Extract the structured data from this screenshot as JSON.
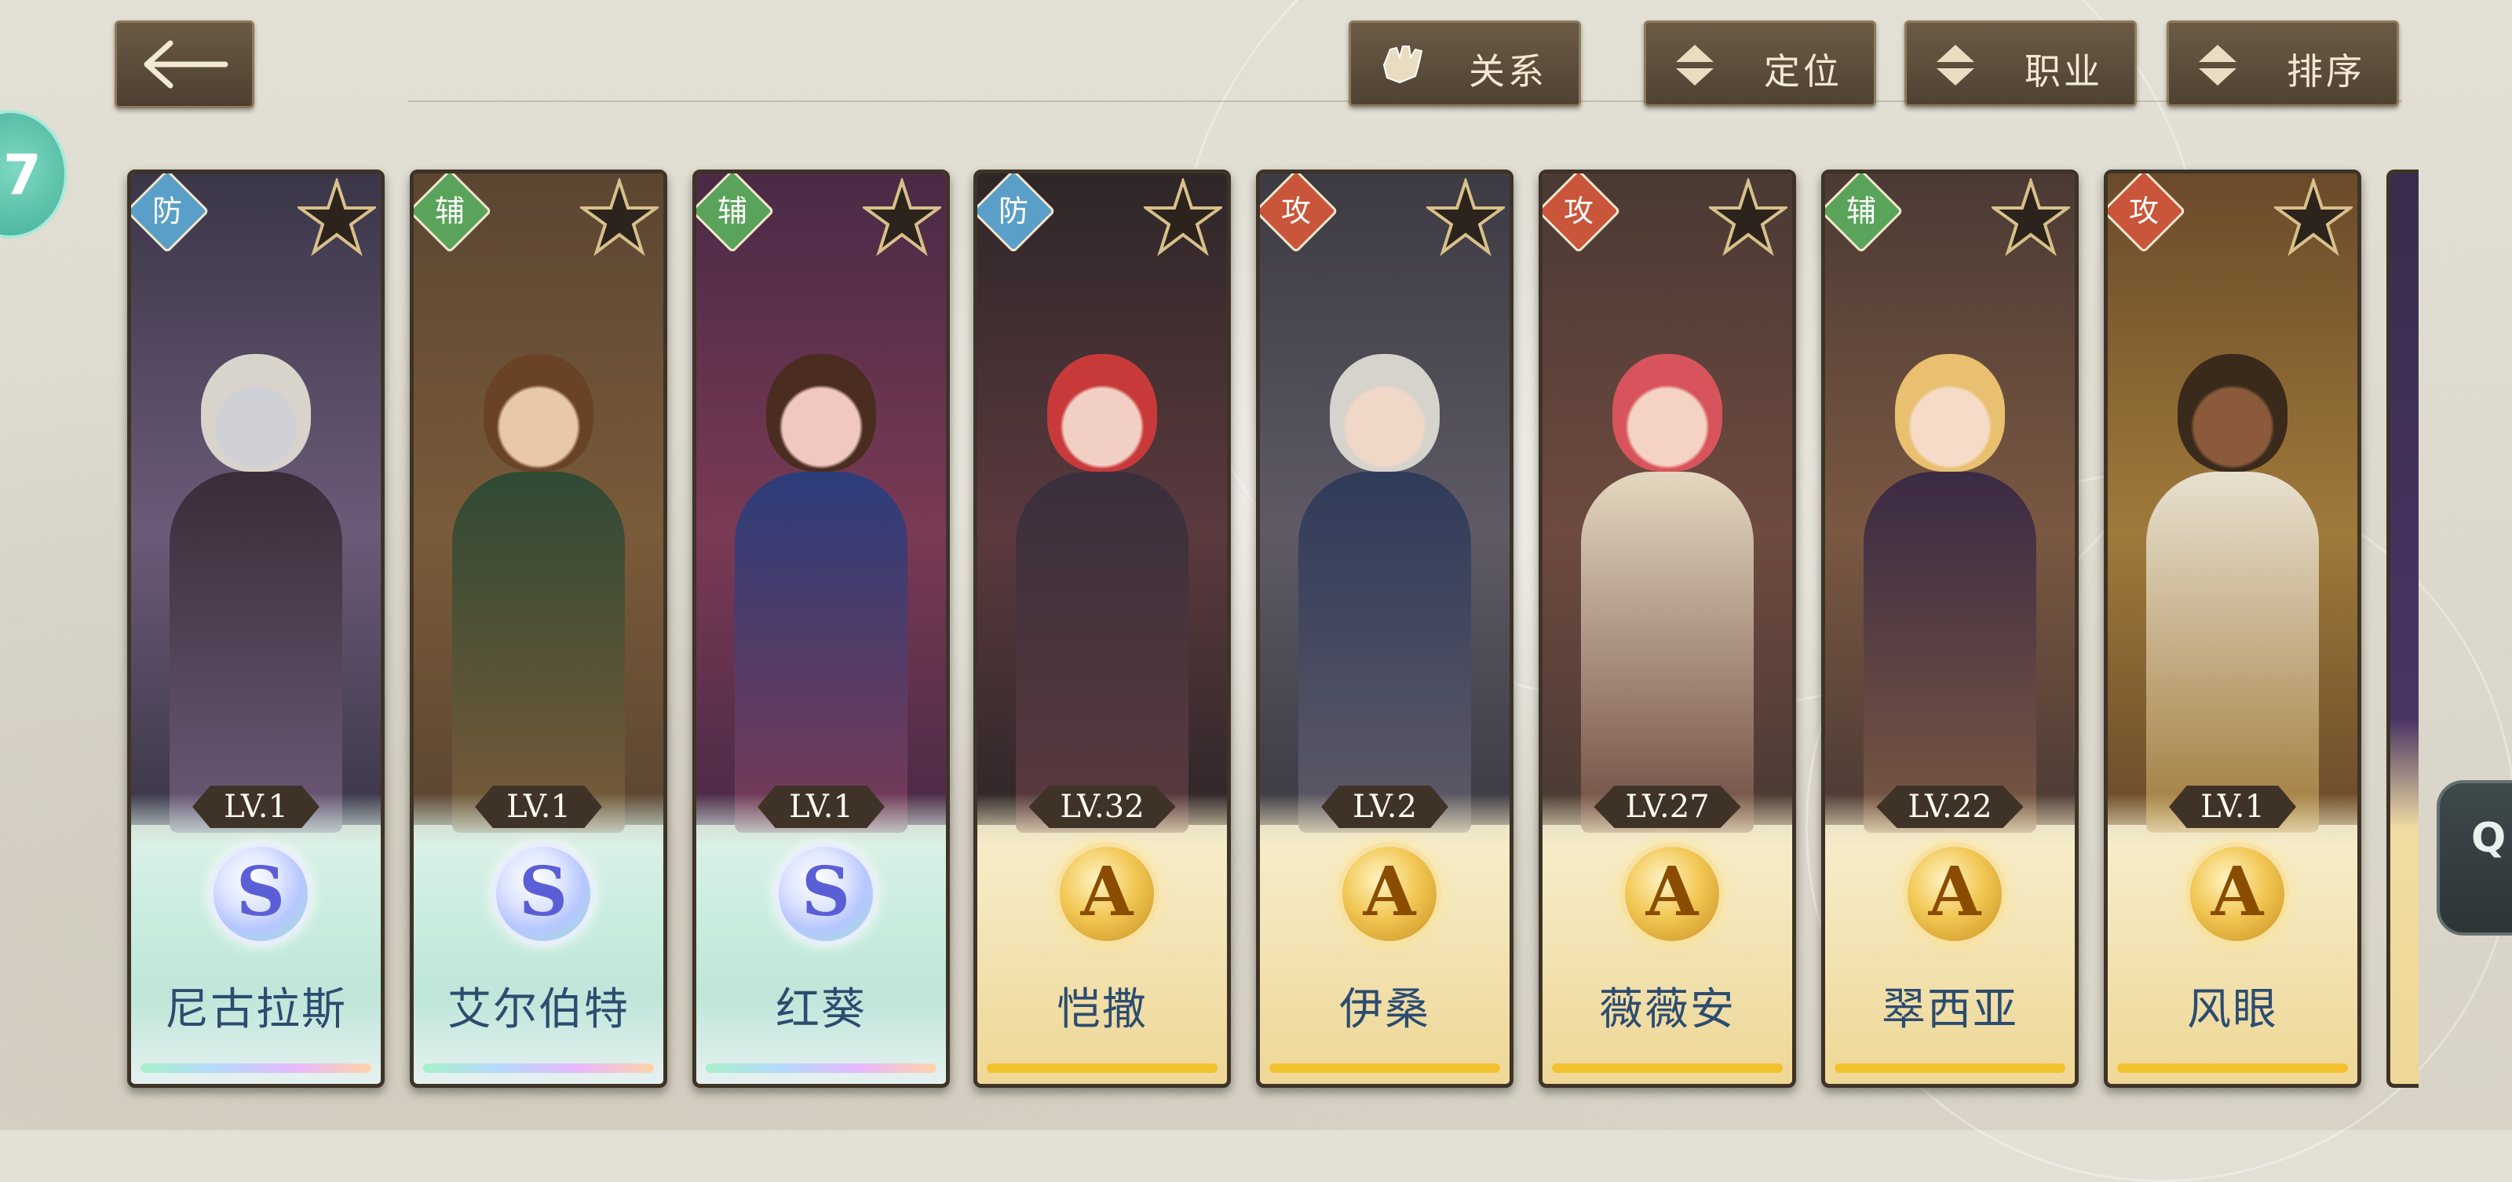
{
  "header": {
    "buttons": [
      {
        "label": "关系",
        "icon": "gauntlet-icon"
      },
      {
        "label": "定位",
        "icon": "sort-updown-icon"
      },
      {
        "label": "职业",
        "icon": "sort-updown-icon"
      },
      {
        "label": "排序",
        "icon": "sort-updown-icon"
      }
    ]
  },
  "side": {
    "badge_text": "7",
    "chat_text": "Q"
  },
  "colors": {
    "def": "#5a9fc7",
    "sup": "#5aa35a",
    "atk": "#c9553a",
    "tier_s": "#5b5fd6",
    "tier_a": "#f2c12e"
  },
  "cards": [
    {
      "role": "防",
      "level": "LV.1",
      "rank": "S",
      "name": "尼古拉斯"
    },
    {
      "role": "辅",
      "level": "LV.1",
      "rank": "S",
      "name": "艾尔伯特"
    },
    {
      "role": "辅",
      "level": "LV.1",
      "rank": "S",
      "name": "红葵"
    },
    {
      "role": "防",
      "level": "LV.32",
      "rank": "A",
      "name": "恺撒"
    },
    {
      "role": "攻",
      "level": "LV.2",
      "rank": "A",
      "name": "伊桑"
    },
    {
      "role": "攻",
      "level": "LV.27",
      "rank": "A",
      "name": "薇薇安"
    },
    {
      "role": "辅",
      "level": "LV.22",
      "rank": "A",
      "name": "翠西亚"
    },
    {
      "role": "攻",
      "level": "LV.1",
      "rank": "A",
      "name": "风眼"
    }
  ]
}
